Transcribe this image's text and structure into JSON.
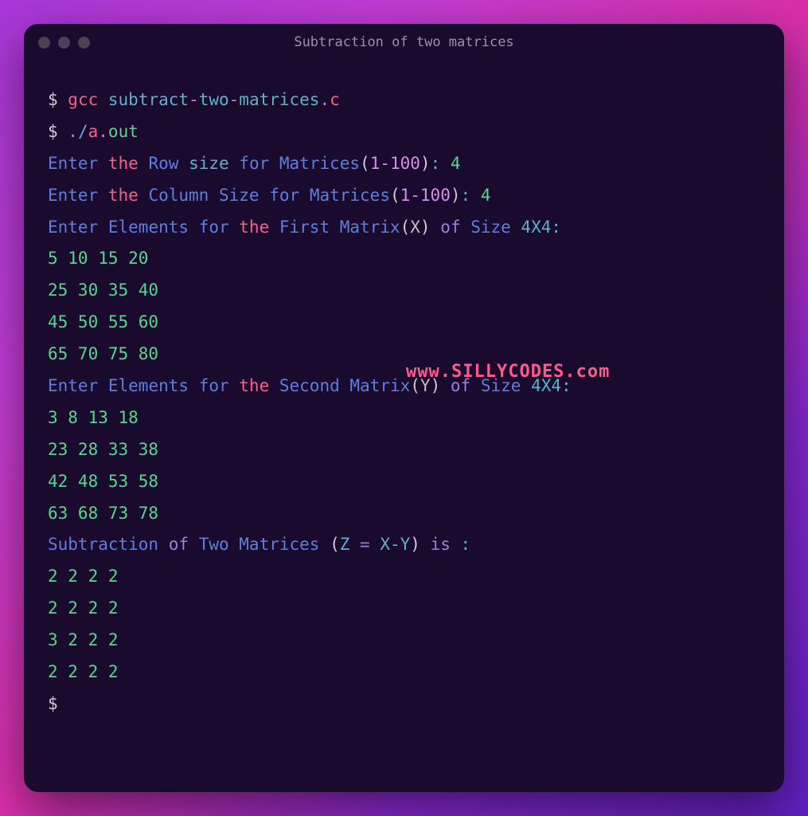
{
  "window": {
    "title": "Subtraction of two matrices"
  },
  "watermark": "www.SILLYCODES.com",
  "lines": {
    "l1_prompt": "$ ",
    "l1_gcc": "gcc",
    "l1_sp1": " ",
    "l1_subtract": "subtract",
    "l1_dash1": "-",
    "l1_two": "two",
    "l1_dash2": "-",
    "l1_matrices": "matrices",
    "l1_dot": ".",
    "l1_c": "c",
    "l2_prompt": "$ ",
    "l2_dot": ".",
    "l2_slash": "/",
    "l2_a": "a",
    "l2_dot2": ".",
    "l2_out": "out",
    "l3_enter": "Enter",
    "l3_sp1": " ",
    "l3_the": "the",
    "l3_sp2": " ",
    "l3_row": "Row",
    "l3_sp3": " ",
    "l3_size": "size",
    "l3_sp4": " ",
    "l3_for": "for",
    "l3_sp5": " ",
    "l3_matrices": "Matrices",
    "l3_paren1": "(",
    "l3_range": "1-100",
    "l3_paren2": ")",
    "l3_colon": ":",
    "l3_sp6": " ",
    "l3_val": "4",
    "l4_enter": "Enter",
    "l4_sp1": " ",
    "l4_the": "the",
    "l4_sp2": " ",
    "l4_col": "Column",
    "l4_sp3": " ",
    "l4_size": "Size",
    "l4_sp4": " ",
    "l4_for": "for",
    "l4_sp5": " ",
    "l4_matrices": "Matrices",
    "l4_paren1": "(",
    "l4_range": "1-100",
    "l4_paren2": ")",
    "l4_colon": ":",
    "l4_sp6": " ",
    "l4_val": "4",
    "l5_enter": "Enter",
    "l5_sp1": " ",
    "l5_elements": "Elements",
    "l5_sp2": " ",
    "l5_for": "for",
    "l5_sp3": " ",
    "l5_the": "the",
    "l5_sp4": " ",
    "l5_first": "First",
    "l5_sp5": " ",
    "l5_matrix": "Matrix",
    "l5_paren1": "(",
    "l5_x": "X",
    "l5_paren2": ")",
    "l5_sp6": " ",
    "l5_of": "of",
    "l5_sp7": " ",
    "l5_sizew": "Size",
    "l5_sp8": " ",
    "l5_dim": "4X4",
    "l5_colon": ":",
    "l6": "5 10 15 20",
    "l7": "25 30 35 40",
    "l8": "45 50 55 60",
    "l9": "65 70 75 80",
    "l10_enter": "Enter",
    "l10_sp1": " ",
    "l10_elements": "Elements",
    "l10_sp2": " ",
    "l10_for": "for",
    "l10_sp3": " ",
    "l10_the": "the",
    "l10_sp4": " ",
    "l10_second": "Second",
    "l10_sp5": " ",
    "l10_matrix": "Matrix",
    "l10_paren1": "(",
    "l10_y": "Y",
    "l10_paren2": ")",
    "l10_sp6": " ",
    "l10_of": "of",
    "l10_sp7": " ",
    "l10_sizew": "Size",
    "l10_sp8": " ",
    "l10_dim": "4X4",
    "l10_colon": ":",
    "l11": "3 8 13 18",
    "l12": "23 28 33 38",
    "l13": "42 48 53 58",
    "l14": "63 68 73 78",
    "l15_sub": "Subtraction",
    "l15_sp1": " ",
    "l15_of": "of",
    "l15_sp2": " ",
    "l15_two": "Two",
    "l15_sp3": " ",
    "l15_matrices": "Matrices",
    "l15_sp4": " ",
    "l15_paren1": "(",
    "l15_z": "Z ",
    "l15_eq": "=",
    "l15_xy": " X-Y",
    "l15_paren2": ")",
    "l15_sp5": " ",
    "l15_is": "is",
    "l15_sp6": " ",
    "l15_colon": ":",
    "l16": "2 2 2 2",
    "l17": "2 2 2 2",
    "l18": "3 2 2 2",
    "l19": "2 2 2 2",
    "l20_prompt": "$"
  }
}
